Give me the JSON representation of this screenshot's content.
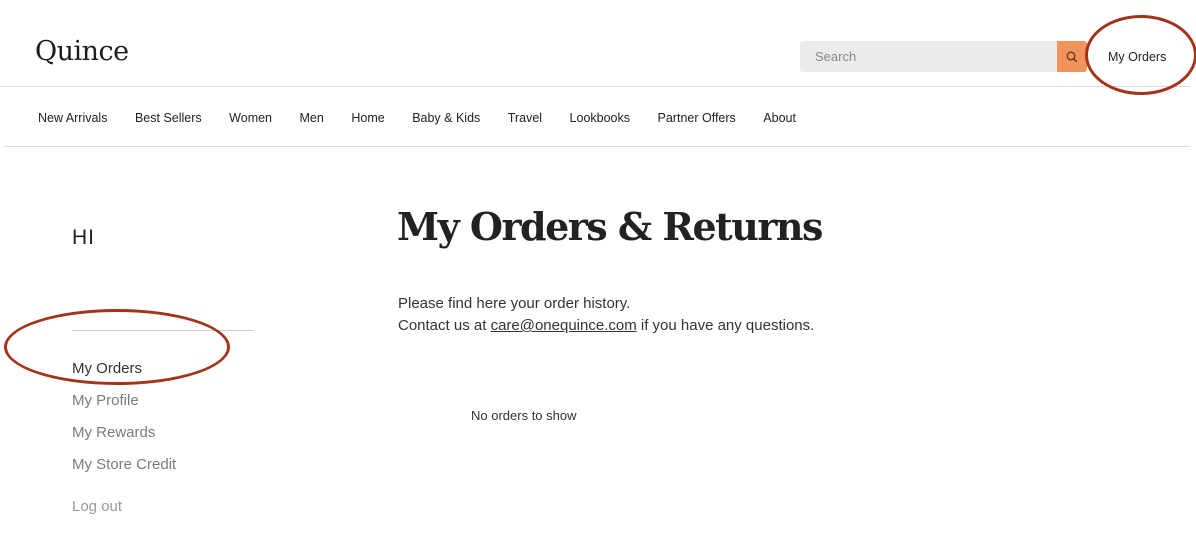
{
  "header": {
    "logo": "Quince",
    "search_placeholder": "Search",
    "orders_link": "My Orders"
  },
  "nav": {
    "items": [
      "New Arrivals",
      "Best Sellers",
      "Women",
      "Men",
      "Home",
      "Baby & Kids",
      "Travel",
      "Lookbooks",
      "Partner Offers",
      "About"
    ]
  },
  "sidebar": {
    "greeting": "HI",
    "items": [
      "My Orders",
      "My Profile",
      "My Rewards",
      "My Store Credit"
    ],
    "logout": "Log out"
  },
  "main": {
    "title": "My Orders & Returns",
    "line1": "Please find here your order history.",
    "line2_prefix": "Contact us at ",
    "email": "care@onequince.com",
    "line2_suffix": " if you have any questions.",
    "empty_message": "No orders to show"
  },
  "colors": {
    "accent": "#f0935c",
    "annotation_circle": "#a3341b"
  }
}
